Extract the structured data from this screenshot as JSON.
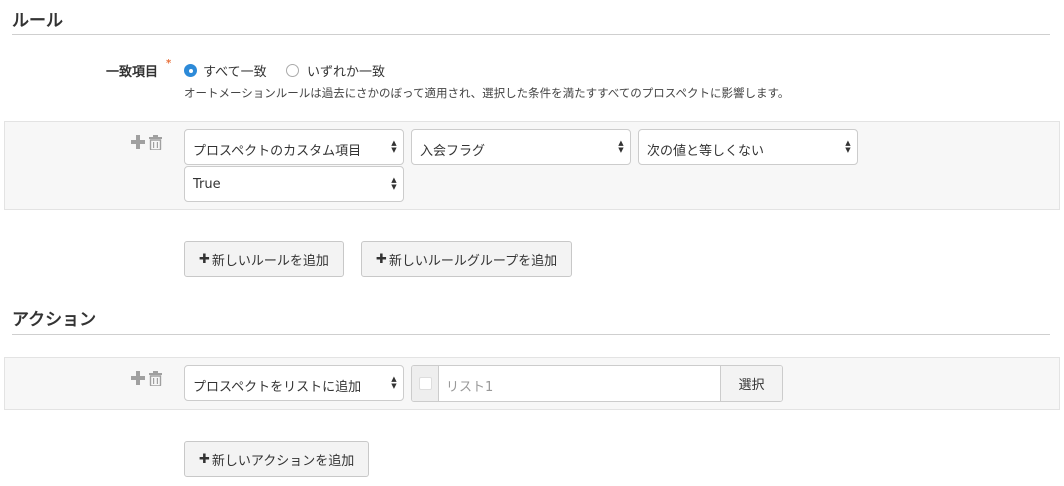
{
  "rules_section": {
    "title": "ルール",
    "match_label": "一致項目",
    "required_mark": "*",
    "options": [
      {
        "label": "すべて一致",
        "selected": true
      },
      {
        "label": "いずれか一致",
        "selected": false
      }
    ],
    "help": "オートメーションルールは過去にさかのぼって適用され、選択した条件を満たすすべてのプロスペクトに影響します。",
    "rule": {
      "field_type": "プロスペクトのカスタム項目",
      "field": "入会フラグ",
      "operator": "次の値と等しくない",
      "value": "True"
    },
    "add_rule": "新しいルールを追加",
    "add_rule_group": "新しいルールグループを追加"
  },
  "actions_section": {
    "title": "アクション",
    "action": {
      "type": "プロスペクトをリストに追加",
      "list_placeholder": "リスト1",
      "select_button": "選択"
    },
    "add_action": "新しいアクションを追加"
  },
  "icons": {
    "add": "plus-icon",
    "delete": "trash-icon"
  },
  "colors": {
    "radio_selected": "#2d8ad8",
    "required": "#e8703a"
  }
}
